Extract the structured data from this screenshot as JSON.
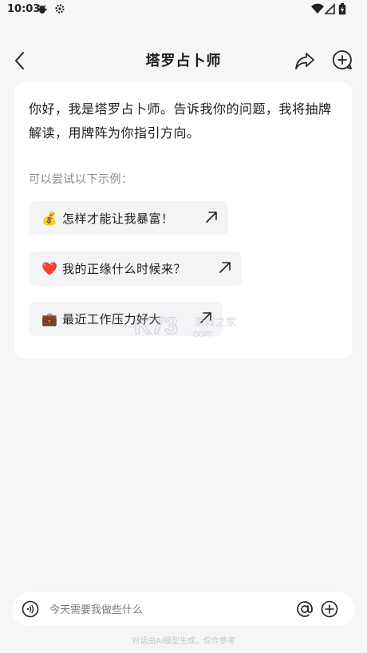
{
  "status_bar": {
    "time": "10:03",
    "icons": [
      "bug-icon",
      "gear-icon",
      "wifi-icon",
      "signal-icon",
      "battery-icon"
    ]
  },
  "header": {
    "title": "塔罗占卜师",
    "icons": [
      "back-icon",
      "share-icon",
      "new-chat-icon"
    ]
  },
  "chat": {
    "greeting": "你好，我是塔罗占卜师。告诉我你的问题，我将抽牌解读，用牌阵为你指引方向。",
    "hint": "可以尝试以下示例：",
    "suggestions": [
      {
        "emoji": "💰",
        "label": "怎样才能让我暴富！"
      },
      {
        "emoji": "❤️",
        "label": "我的正缘什么时候来？"
      },
      {
        "emoji": "💼",
        "label": "最近工作压力好大"
      }
    ]
  },
  "watermark": {
    "logo": "K73",
    "text": "游戏之家",
    "domain": ".com"
  },
  "input": {
    "placeholder": "今天需要我做些什么"
  },
  "footer": {
    "disclaimer": "对话由AI模型生成，仅作参考"
  }
}
